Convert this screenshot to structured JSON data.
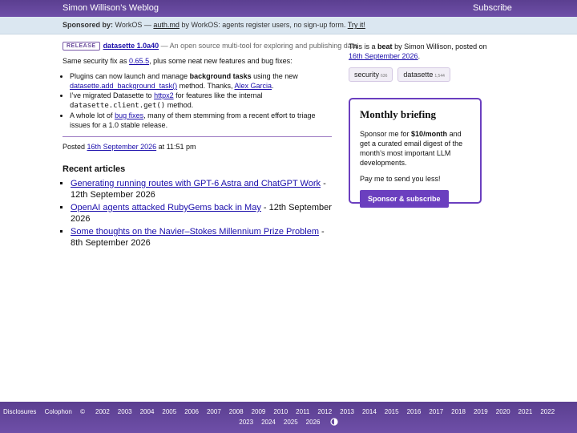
{
  "header": {
    "site_title": "Simon Willison’s Weblog",
    "subscribe": "Subscribe"
  },
  "sponsor": {
    "label": "Sponsored by:",
    "text1": "WorkOS —",
    "link": "auth.md",
    "text2": "by WorkOS: agents register users, no sign-up form.",
    "cta": "Try it!"
  },
  "entry": {
    "badge": "RELEASE",
    "title": "datasette 1.0a40",
    "subtitle": "— An open source multi-tool for exploring and publishing data",
    "intro_a": "Same security fix as",
    "intro_link": "0.65.5",
    "intro_b": ", plus some neat new features and bug fixes:",
    "bullets": {
      "b1_a": "Plugins can now launch and manage",
      "b1_bold": "background tasks",
      "b1_b": "using the new",
      "b1_link": "datasette.add_background_task()",
      "b1_c": "method. Thanks,",
      "b1_link2": "Alex Garcia",
      "b1_d": ".",
      "b2_a": "I’ve migrated Datasette to",
      "b2_link": "httpx2",
      "b2_b": "for features like the internal",
      "b2_code": "datasette.client.get()",
      "b2_c": "method.",
      "b3_a": "A whole lot of",
      "b3_link": "bug fixes",
      "b3_b": ", many of them stemming from a recent effort to triage issues for a 1.0 stable release."
    },
    "posted_label": "Posted",
    "posted_date": "16th September 2026",
    "posted_time": "at 11:51 pm"
  },
  "recent": {
    "heading": "Recent articles",
    "items": [
      {
        "title": "Generating running routes with GPT-6 Astra and ChatGPT Work",
        "date": "- 12th September 2026"
      },
      {
        "title": "OpenAI agents attacked RubyGems back in May",
        "date": "- 12th September 2026"
      },
      {
        "title": "Some thoughts on the Navier–Stokes Millennium Prize Problem",
        "date": "- 8th September 2026"
      }
    ]
  },
  "sidebar": {
    "intro_a": "This is a",
    "intro_bold": "beat",
    "intro_b": "by Simon Willison, posted on",
    "intro_date": "16th September 2026",
    "intro_end": ".",
    "tags": [
      {
        "name": "security",
        "count": "636"
      },
      {
        "name": "datasette",
        "count": "1,544"
      }
    ]
  },
  "briefing": {
    "title": "Monthly briefing",
    "text_a": "Sponsor me for",
    "price": "$10/month",
    "text_b": "and get a curated email digest of the month’s most important LLM developments.",
    "pay": "Pay me to send you less!",
    "button": "Sponsor & subscribe"
  },
  "footer": {
    "disclosures": "Disclosures",
    "colophon": "Colophon",
    "copyright": "©",
    "years_row1": [
      "2002",
      "2003",
      "2004",
      "2005",
      "2006",
      "2007",
      "2008",
      "2009",
      "2010",
      "2011",
      "2012",
      "2013",
      "2014",
      "2015",
      "2016",
      "2017",
      "2018",
      "2019",
      "2020",
      "2021",
      "2022"
    ],
    "years_row2": [
      "2023",
      "2024",
      "2025",
      "2026"
    ],
    "theme_icon": "contrast-icon"
  }
}
